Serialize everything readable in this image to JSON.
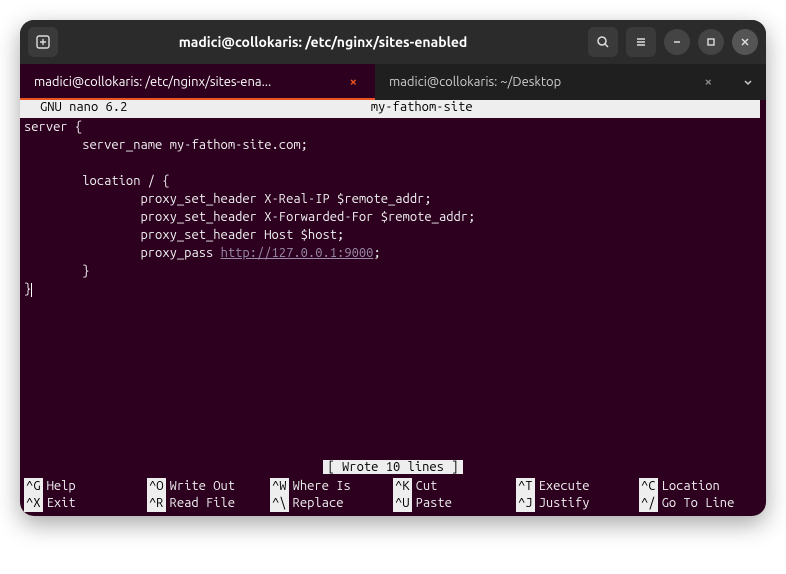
{
  "titlebar": {
    "title": "madici@collokaris: /etc/nginx/sites-enabled"
  },
  "tabs": [
    {
      "label": "madici@collokaris: /etc/nginx/sites-ena...",
      "active": true
    },
    {
      "label": "madici@collokaris: ~/Desktop",
      "active": false
    }
  ],
  "nano": {
    "version": "GNU nano 6.2",
    "filename": "my-fathom-site",
    "status": "[ Wrote 10 lines ]"
  },
  "file": {
    "l1": "server {",
    "l2": "        server_name my-fathom-site.com;",
    "l3": "",
    "l4": "        location / {",
    "l5": "                proxy_set_header X-Real-IP $remote_addr;",
    "l6": "                proxy_set_header X-Forwarded-For $remote_addr;",
    "l7": "                proxy_set_header Host $host;",
    "l8a": "                proxy_pass ",
    "l8url": "http://127.0.0.1:9000",
    "l8b": ";",
    "l9": "        }",
    "l10": "}"
  },
  "help": {
    "r1": [
      {
        "key": "^G",
        "label": "Help"
      },
      {
        "key": "^O",
        "label": "Write Out"
      },
      {
        "key": "^W",
        "label": "Where Is"
      },
      {
        "key": "^K",
        "label": "Cut"
      },
      {
        "key": "^T",
        "label": "Execute"
      },
      {
        "key": "^C",
        "label": "Location"
      }
    ],
    "r2": [
      {
        "key": "^X",
        "label": "Exit"
      },
      {
        "key": "^R",
        "label": "Read File"
      },
      {
        "key": "^\\",
        "label": "Replace"
      },
      {
        "key": "^U",
        "label": "Paste"
      },
      {
        "key": "^J",
        "label": "Justify"
      },
      {
        "key": "^/",
        "label": "Go To Line"
      }
    ]
  }
}
